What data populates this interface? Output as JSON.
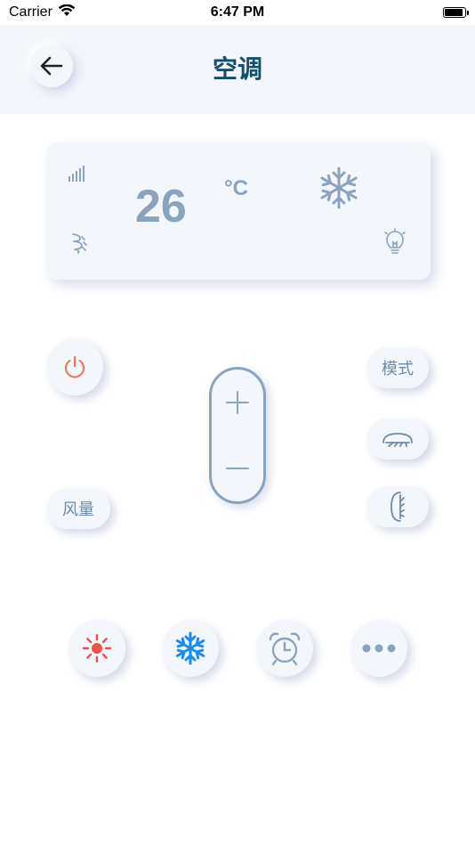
{
  "status_bar": {
    "carrier": "Carrier",
    "time": "6:47 PM"
  },
  "header": {
    "title": "空调",
    "back_icon": "arrow-left-icon"
  },
  "display": {
    "temperature": "26",
    "unit": "°C",
    "icons": [
      "signal-bars-icon",
      "fan-speed-icon",
      "snowflake-icon",
      "light-bulb-icon"
    ]
  },
  "controls": {
    "power_icon": "power-icon",
    "mode_label": "模式",
    "fan_label": "风量",
    "swing_horizontal_icon": "swing-horizontal-icon",
    "swing_vertical_icon": "swing-vertical-icon",
    "temp_up_icon": "plus-icon",
    "temp_down_icon": "minus-icon"
  },
  "bottom_bar": {
    "items": [
      {
        "icon": "sun-icon",
        "color": "#f0524a"
      },
      {
        "icon": "snowflake-icon",
        "color": "#1a8cf0"
      },
      {
        "icon": "alarm-clock-icon",
        "color": "#8aa4bf"
      },
      {
        "icon": "more-dots-icon",
        "color": "#8aa4bf"
      }
    ]
  },
  "colors": {
    "accent": "#8aa4bf",
    "title": "#13506e",
    "power": "#ef7a5a",
    "background": "#f3f6fb"
  }
}
